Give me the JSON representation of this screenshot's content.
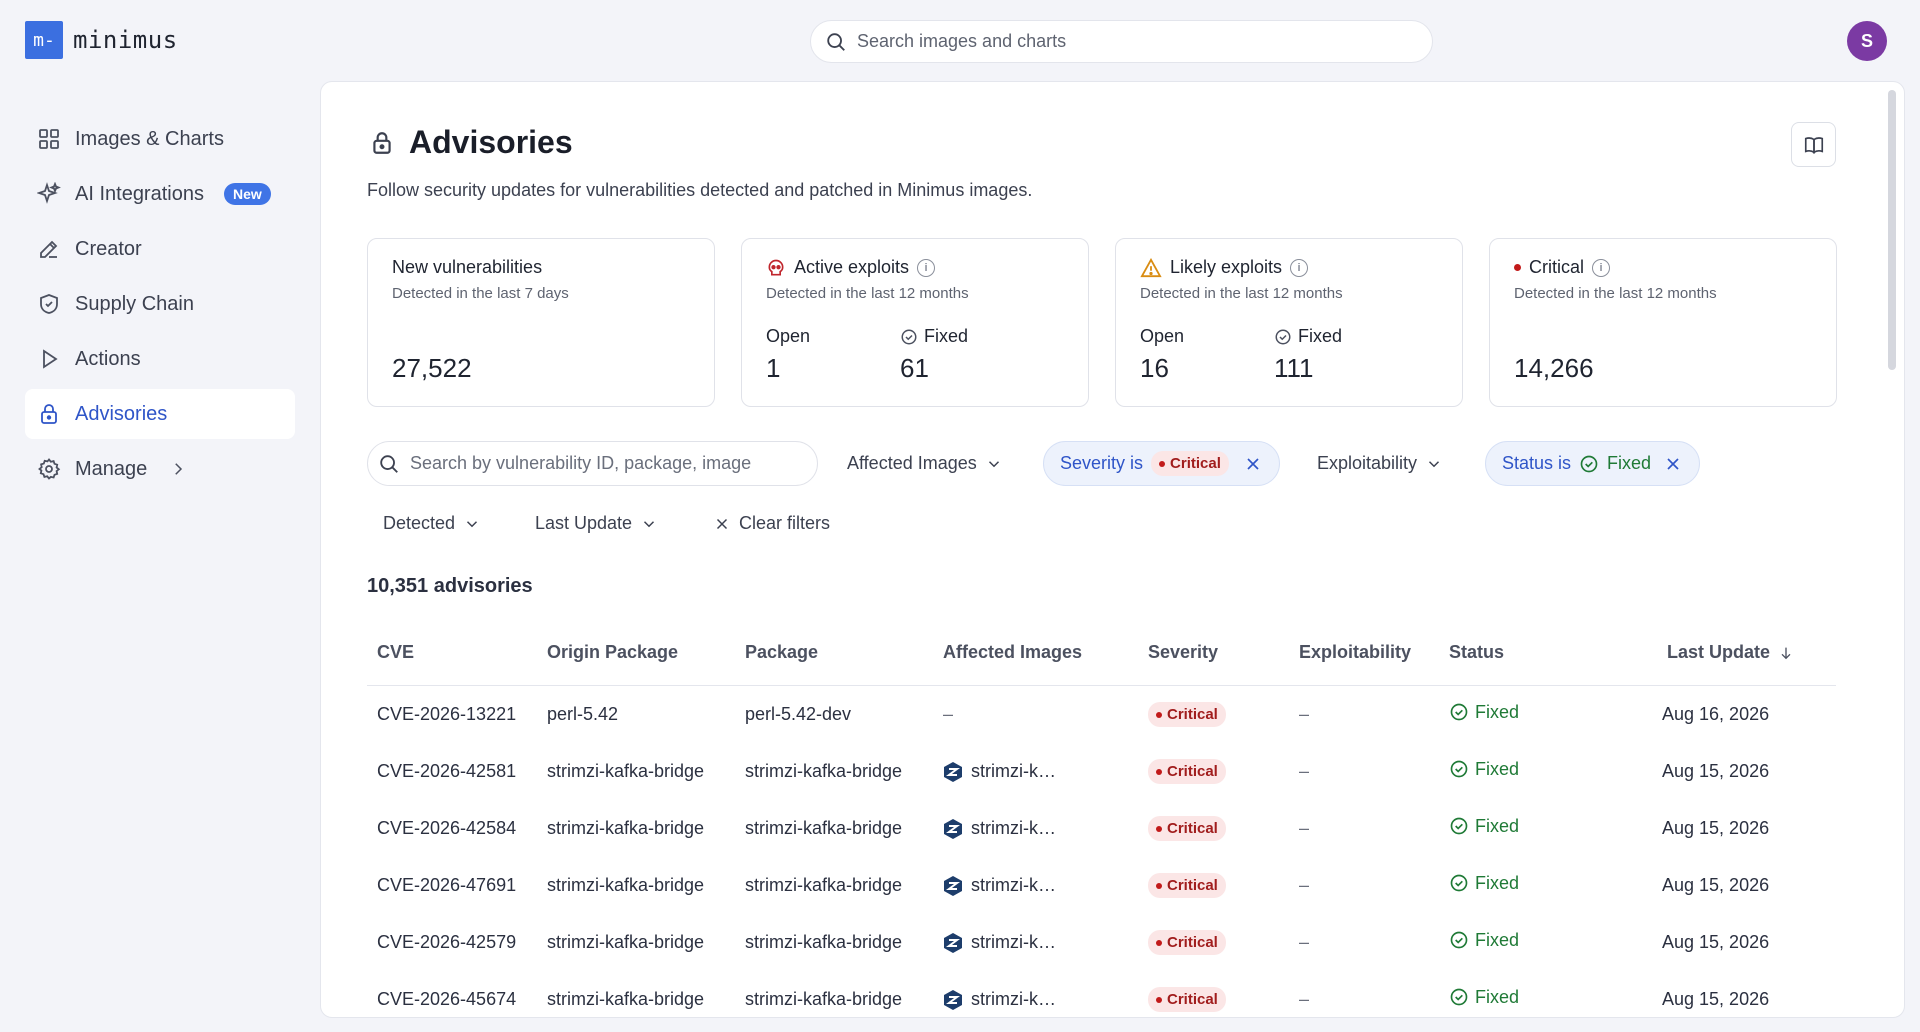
{
  "app": {
    "logo_mark": "m-",
    "name": "minimus"
  },
  "global_search": {
    "placeholder": "Search images and charts"
  },
  "user": {
    "initial": "S",
    "color": "#7b3aa3"
  },
  "sidebar": {
    "items": [
      {
        "label": "Images & Charts",
        "icon": "grid-icon"
      },
      {
        "label": "AI Integrations",
        "icon": "sparkle-icon",
        "badge": "New"
      },
      {
        "label": "Creator",
        "icon": "pencil-icon"
      },
      {
        "label": "Supply Chain",
        "icon": "shield-icon"
      },
      {
        "label": "Actions",
        "icon": "play-icon"
      },
      {
        "label": "Advisories",
        "icon": "lock-icon",
        "active": true
      },
      {
        "label": "Manage",
        "icon": "gear-icon"
      }
    ]
  },
  "page": {
    "title": "Advisories",
    "subtitle": "Follow security updates for vulnerabilities detected and patched in Minimus images."
  },
  "stats": {
    "new_vulns": {
      "title": "New vulnerabilities",
      "sub": "Detected in the last 7 days",
      "value": "27,522"
    },
    "active_exploits": {
      "title": "Active exploits",
      "sub": "Detected in the last 12 months",
      "open_label": "Open",
      "open": "1",
      "fixed_label": "Fixed",
      "fixed": "61"
    },
    "likely_exploits": {
      "title": "Likely exploits",
      "sub": "Detected in the last 12 months",
      "open_label": "Open",
      "open": "16",
      "fixed_label": "Fixed",
      "fixed": "111"
    },
    "critical": {
      "title": "Critical",
      "sub": "Detected in the last 12 months",
      "value": "14,266"
    }
  },
  "filters": {
    "search_placeholder": "Search by vulnerability ID, package, image",
    "affected_images": "Affected Images",
    "severity_prefix": "Severity is",
    "severity_value": "Critical",
    "exploitability": "Exploitability",
    "status_prefix": "Status is",
    "status_value": "Fixed",
    "detected": "Detected",
    "last_update": "Last Update",
    "clear": "Clear filters"
  },
  "count_label": "10,351 advisories",
  "table": {
    "headers": [
      "CVE",
      "Origin Package",
      "Package",
      "Affected Images",
      "Severity",
      "Exploitability",
      "Status",
      "Last Update"
    ],
    "rows": [
      {
        "cve": "CVE-2026-13221",
        "origin": "perl-5.42",
        "package": "perl-5.42-dev",
        "image": "–",
        "severity": "Critical",
        "exploit": "–",
        "status": "Fixed",
        "updated": "Aug 16, 2026"
      },
      {
        "cve": "CVE-2026-42581",
        "origin": "strimzi-kafka-bridge",
        "package": "strimzi-kafka-bridge",
        "image": "strimzi-kafka-bridge",
        "severity": "Critical",
        "exploit": "–",
        "status": "Fixed",
        "updated": "Aug 15, 2026"
      },
      {
        "cve": "CVE-2026-42584",
        "origin": "strimzi-kafka-bridge",
        "package": "strimzi-kafka-bridge",
        "image": "strimzi-kafka-bridge",
        "severity": "Critical",
        "exploit": "–",
        "status": "Fixed",
        "updated": "Aug 15, 2026"
      },
      {
        "cve": "CVE-2026-47691",
        "origin": "strimzi-kafka-bridge",
        "package": "strimzi-kafka-bridge",
        "image": "strimzi-kafka-bridge",
        "severity": "Critical",
        "exploit": "–",
        "status": "Fixed",
        "updated": "Aug 15, 2026"
      },
      {
        "cve": "CVE-2026-42579",
        "origin": "strimzi-kafka-bridge",
        "package": "strimzi-kafka-bridge",
        "image": "strimzi-kafka-bridge",
        "severity": "Critical",
        "exploit": "–",
        "status": "Fixed",
        "updated": "Aug 15, 2026"
      },
      {
        "cve": "CVE-2026-45674",
        "origin": "strimzi-kafka-bridge",
        "package": "strimzi-kafka-bridge",
        "image": "strimzi-kafka-bridge",
        "severity": "Critical",
        "exploit": "–",
        "status": "Fixed",
        "updated": "Aug 15, 2026"
      }
    ]
  }
}
